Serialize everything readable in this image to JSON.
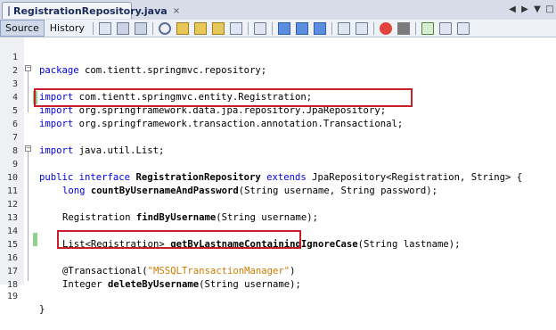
{
  "tab": {
    "label": "RegistrationRepository.java",
    "close": "×"
  },
  "toolbar": {
    "source_label": "Source",
    "history_label": "History"
  },
  "code_lines": [
    {
      "n": "1"
    },
    {
      "n": "2"
    },
    {
      "n": "3"
    },
    {
      "n": "4"
    },
    {
      "n": "5"
    },
    {
      "n": "6"
    },
    {
      "n": "7"
    },
    {
      "n": "8"
    },
    {
      "n": "9"
    },
    {
      "n": "10"
    },
    {
      "n": "11"
    },
    {
      "n": "12"
    },
    {
      "n": "13"
    },
    {
      "n": "14"
    },
    {
      "n": "15"
    },
    {
      "n": "16"
    },
    {
      "n": "17"
    },
    {
      "n": "18"
    },
    {
      "n": "19"
    }
  ],
  "code": {
    "l1_kw": "package",
    "l1_rest": " com.tientt.springmvc.repository;",
    "l3_kw": "import",
    "l3_rest": " com.tientt.springmvc.entity.Registration;",
    "l4_kw": "import",
    "l4_rest": " org.springframework.data.jpa.repository.JpaRepository;",
    "l5_kw": "import",
    "l5_rest": " org.springframework.transaction.annotation.Transactional;",
    "l6_kw": "import",
    "l6_rest": " java.util.List;",
    "l9_kw1": "public interface",
    "l9_name": " RegistrationRepository",
    "l9_kw2": " extends",
    "l9_rest": " JpaRepository<Registration, String> {",
    "l10_kw": "long",
    "l10_method": " countByUsernameAndPassword",
    "l10_rest": "(String username, String password);",
    "l12_pre": "Registration",
    "l12_method": " findByUsername",
    "l12_rest": "(String username);",
    "l14_pre": "List<Registration>",
    "l14_method": " getByLastnameContainingIgnoreCase",
    "l14_rest": "(String lastname);",
    "l16_ann": "@Transactional(",
    "l16_str": "\"MSSQLTransactionManager\"",
    "l16_end": ")",
    "l17_pre": "Integer",
    "l17_method": " deleteByUsername",
    "l17_rest": "(String username);",
    "l19": "}"
  },
  "colors": {
    "keyword": "#0000e6",
    "string": "#ce7b00",
    "highlight_box": "#c8202a",
    "change_marker": "#8fd18f"
  }
}
